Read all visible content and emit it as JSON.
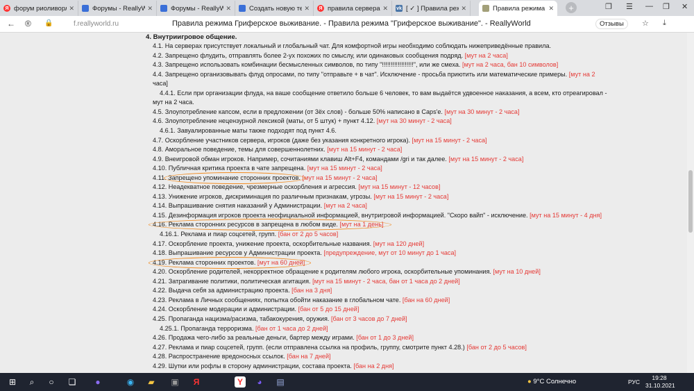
{
  "tabs": [
    {
      "title": "форум риоливорлд",
      "favicon": "yandex"
    },
    {
      "title": "Форумы - ReallyWorld",
      "favicon": "reallyworld"
    },
    {
      "title": "Форумы - ReallyWorld",
      "favicon": "reallyworld"
    },
    {
      "title": "Создать новую тему - R",
      "favicon": "reallyworld"
    },
    {
      "title": "правила сервера рил",
      "favicon": "yandex"
    },
    {
      "title": "[ ✓ ] Правила режима",
      "favicon": "vk"
    },
    {
      "title": "Правила режима Гр",
      "favicon": "doc",
      "active": true
    }
  ],
  "addressbar": {
    "url": "f.reallyworld.ru",
    "page_title": "Правила режима Гриферское выживание. - Правила режима \"Гриферское выживание\". - ReallyWorld",
    "reviews_label": "Отзывы"
  },
  "rules": {
    "section_title": "4. Внутриигровое общение.",
    "items": [
      {
        "text": "4.1. На серверах присутствует локальный и глобальный чат. Для комфортной игры необходимо соблюдать нижеприведённые правила.",
        "penalty": ""
      },
      {
        "text": "4.2. Запрещено флудить, отправлять более 2-ух похожих по смыслу, или одинаковых сообщения подряд.",
        "penalty": "[мут на 2 часа]"
      },
      {
        "text": "4.3. Запрещено использовать комбинации бесмысленных символов, по типу \"!!!!!!!!!!!!!!!!!!\", или же смеха.",
        "penalty": "[мут на 2 часа, бан 10 символов]"
      },
      {
        "text": "4.4. Запрещено организовывать флуд опросами, по типу \"отправьте + в чат\". Исключение - просьба приютить или математические примеры.",
        "penalty": "[мут на 2"
      },
      {
        "text": "часа]",
        "penalty": ""
      },
      {
        "text": "4.4.1. Если при организации флуда, на ваше сообщение ответило больше 6 человек, то вам выдаётся удвоенное наказания, а всем, кто отреагировал -",
        "penalty": ""
      },
      {
        "text": "мут на 2 часа.",
        "penalty": ""
      },
      {
        "text": "4.5. Злоупотребление капсом, если в предложении (от 3ёх слов) - больше 50% написано в Caps'e.",
        "penalty": "[мут на 30 минут - 2 часа]"
      },
      {
        "text": "4.6. Злоупотребление нецензурной лексикой (маты, от 5 штук) + пункт 4.12.",
        "penalty": "[мут на 30 минут - 2 часа]"
      },
      {
        "text": "4.6.1. Завуалированные маты также подходят под пункт 4.6.",
        "penalty": ""
      },
      {
        "text": "4.7. Оскорбление участников сервера, игроков (даже без указания конкретного игрока).",
        "penalty": "[мут на 15 минут - 2 часа]"
      },
      {
        "text": "4.8. Аморальное поведение, темы для совершеннолетних.",
        "penalty": "[мут на 15 минут - 2 часа]"
      },
      {
        "text": "4.9. Внеигровой обман игроков. Например, сочитаниями клавиш Alt+F4, командами /gri и так далее.",
        "penalty": "[мут на 15 минут - 2 часа]"
      },
      {
        "text": "4.10. Публичная критика проекта в чате запрещена.",
        "penalty": "[мут на 15 минут - 2 часа]"
      },
      {
        "text": "4.11. Запрещено упоминание сторонних проектов.",
        "penalty": "[мут на 15 минут - 2 часа]"
      },
      {
        "text": "4.12. Неадекватное поведение, чрезмерные оскорбления и агрессия.",
        "penalty": "[мут на 15 минут - 12 часов]"
      },
      {
        "text": "4.13. Унижение игроков, дискриминация по различным признакам, угрозы.",
        "penalty": "[мут на 15 минут - 2 часа]"
      },
      {
        "text": "4.14. Выпрашивание снятия наказаний у Администрации.",
        "penalty": "[мут на 2 часа]"
      },
      {
        "text": "4.15. Дезинформация игроков проекта неофициальной информацией, внутригровой информацией. \"Скоро вайп\" - исключение.",
        "penalty": "[мут на 15 минут - 4 дня]"
      },
      {
        "text": "4.16. Реклама сторонних ресурсов в запрещена в любом виде.",
        "penalty": "[мут на 1 день]"
      },
      {
        "text": "4.16.1. Реклама и пиар соцсетей, групп.",
        "penalty": "[бан от 2 до 5 часов]"
      },
      {
        "text": "4.17. Оскорбление проекта, унижение проекта, оскорбительные названия.",
        "penalty": "[мут на 120 дней]"
      },
      {
        "text": "4.18. Выпрашивание ресурсов у Администрации проекта.",
        "penalty": "[предупреждение, мут от 10 минут до 1 часа]"
      },
      {
        "text": "4.19. Реклама сторонних проектов.",
        "penalty": "[мут на 60 дней]"
      },
      {
        "text": "4.20. Оскорбление родителей, некорректное обращение к родителям любого игрока, оскорбительные упоминания.",
        "penalty": "[мут на 10 дней]"
      },
      {
        "text": "4.21. Затрагивание политики, политическая агитация.",
        "penalty": "[мут на 15 минут - 2 часа, бан от 1 часа до 2 дней]"
      },
      {
        "text": "4.22. Выдача себя за администрацию проекта.",
        "penalty": "[бан на 3 дня]"
      },
      {
        "text": "4.23. Реклама в Личных сообщениях, попытка обойти наказание в глобальном чате.",
        "penalty": "[бан на 60 дней]"
      },
      {
        "text": "4.24. Оскорбление модерации и администрации.",
        "penalty": "[бан от 5 до 15 дней]"
      },
      {
        "text": "4.25. Пропаганда нацизма/расизма, табакокурения, оружия.",
        "penalty": "[бан от 3 часов до 7 дней]"
      },
      {
        "text": "4.25.1. Пропаганда терроризма.",
        "penalty": "[бан от 1 часа до 2 дней]"
      },
      {
        "text": "4.26. Продажа чего-либо за реальные деньги, бартер между играми.",
        "penalty": "[бан от 1 до 3 дней]"
      },
      {
        "text": "4.27. Реклама и пиар соцсетей, групп. (если отправлена ссылка на профиль, группу, смотрите пункт 4.28.)",
        "penalty": "[бан от 2 до 5 часов]"
      },
      {
        "text": "4.28. Распространение вредоносных ссылок.",
        "penalty": "[бан на 7 дней]"
      },
      {
        "text": "4.29. Шутки или рофлы в сторону администрации, состава проекта.",
        "penalty": "[бан на 2 дня]"
      }
    ]
  },
  "taskbar": {
    "weather": "9°C  Солнечно",
    "lang": "РУС",
    "time": "19:28",
    "date": "31.10.2021"
  },
  "colors": {
    "penalty": "#e53935",
    "highlight_circle": "#f08a1f",
    "taskbar": "#1f2430"
  }
}
